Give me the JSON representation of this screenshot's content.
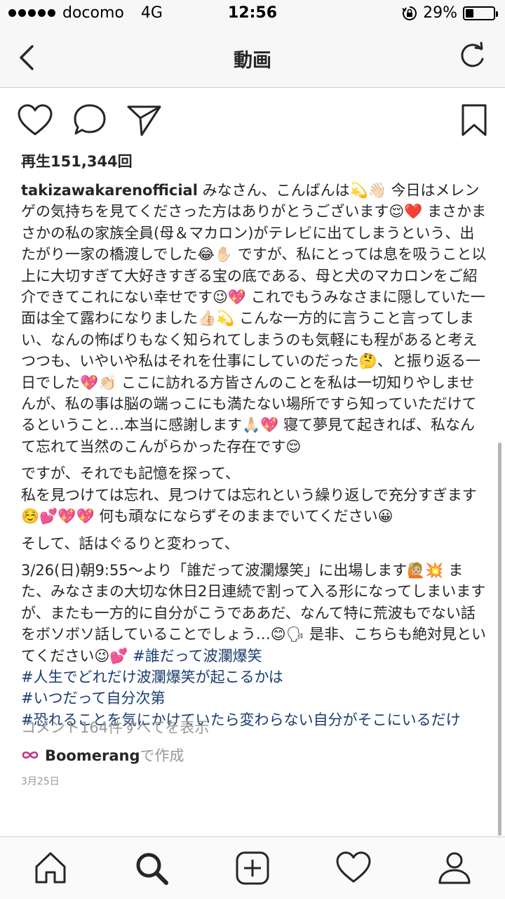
{
  "status_bar": {
    "carrier": "docomo",
    "network": "4G",
    "time": "12:56",
    "battery_percent": "29%",
    "battery_level": 0.29
  },
  "nav": {
    "title": "動画",
    "back_icon": "chevron-left-icon",
    "refresh_icon": "refresh-icon"
  },
  "post": {
    "views": "再生151,344回",
    "username": "takizawakarenofficial",
    "caption": {
      "p1": "みなさん、こんばんは💫👋🏻 今日はメレンゲの気持ちを見てくださった方はありがとうございます😌❤️ まさかまさかの私の家族全員(母＆マカロン)がテレビに出てしまうという、出たがり一家の橋渡しでした😂✋🏻 ですが、私にとっては息を吸うこと以上に大切すぎて大好きすぎる宝の底である、母と犬のマカロンをご紹介できてこれにない幸せです😉💖 これでもうみなさまに隠していた一面は全て露わになりました👍🏻💫 こんな一方的に言うこと言ってしまい、なんの怖ばりもなく知られてしまうのも気軽にも程があると考えつつも、いやいや私はそれを仕事にしていのだった🤔、と振り返る一日でした💖👏🏻 ここに訪れる方皆さんのことを私は一切知りやしませんが、私の事は脳の端っこにも満たない場所ですら知っていただけてるということ…本当に感謝します🙏🏻💖 寝て夢見て起きれば、私なんて忘れて当然のこんがらかった存在です😌",
      "p2a": "ですが、それでも記憶を探って、",
      "p2b": "私を見つけては忘れ、見つけては忘れという繰り返しで充分すぎます☺️💕💖💖 何も頑なにならずそのままでいてください😀",
      "p3": "そして、話はぐるりと変わって、",
      "p4": "3/26(日)朝9:55〜より「誰だって波瀾爆笑」に出場します🙋🏼💥 また、みなさまの大切な休日2日連続で割って入る形になってしまいますが、またも一方的に自分がこうでああだ、なんて特に荒波もでない話をボソボソ話していることでしょう…😊🗣 是非、こちらも絶対見といてください😉💕 ",
      "hashtag1": "#誰だって波瀾爆笑",
      "hashtag2": "#人生でどれだけ波瀾爆笑が起こるかは",
      "hashtag3": "#いつだって自分次第",
      "hashtag4": "#恐れることを気にかけていたら変わらない自分がそこにいるだけ"
    },
    "comments_link": "コメント164件すべてを表示",
    "boomerang_name": "Boomerang",
    "boomerang_suffix": "で作成",
    "date": "3月25日"
  },
  "colors": {
    "hashtag": "#1a3d6f",
    "muted": "#999999",
    "text": "#262626"
  }
}
